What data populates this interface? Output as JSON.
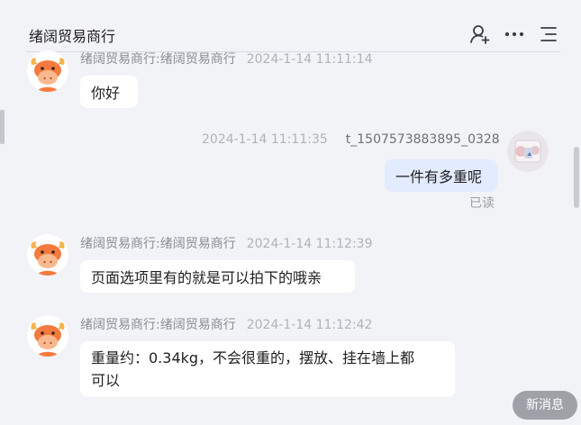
{
  "header": {
    "title": "绪阔贸易商行",
    "icons": [
      "add-user-icon",
      "more-icon",
      "menu-icon"
    ]
  },
  "messages": [
    {
      "side": "left",
      "sender": "绪阔贸易商行:绪阔贸易商行",
      "time": "2024-1-14 11:11:14",
      "text": "你好"
    },
    {
      "side": "right",
      "sender": "t_1507573883895_0328",
      "time": "2024-1-14 11:11:35",
      "text": "一件有多重呢",
      "status": "已读"
    },
    {
      "side": "left",
      "sender": "绪阔贸易商行:绪阔贸易商行",
      "time": "2024-1-14 11:12:39",
      "text": "页面选项里有的就是可以拍下的哦亲"
    },
    {
      "side": "left",
      "sender": "绪阔贸易商行:绪阔贸易商行",
      "time": "2024-1-14 11:12:42",
      "text_line1": "重量约：0.34kg，不会很重的，摆放、挂在墙上都",
      "text_line2": "可以"
    }
  ],
  "new_message_button": "新消息",
  "colors": {
    "background": "#f2f3f7",
    "bubble_other": "#ffffff",
    "bubble_mine": "#e3ebfe",
    "avatar_bull": "#f47a3e"
  }
}
